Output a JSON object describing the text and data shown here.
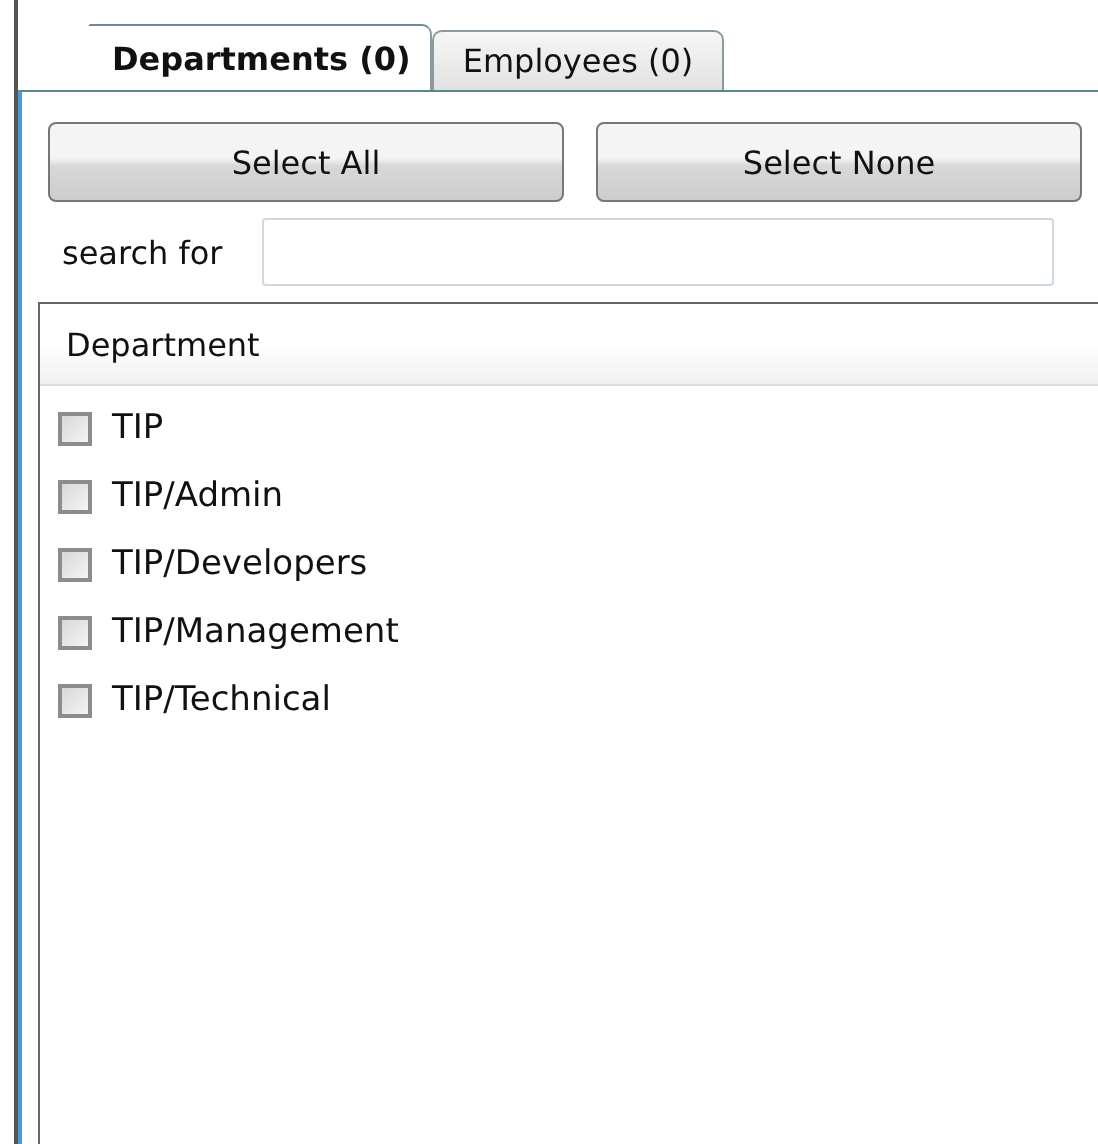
{
  "tabs": [
    {
      "label": "Departments (0)",
      "selected": true
    },
    {
      "label": "Employees (0)",
      "selected": false
    }
  ],
  "buttons": [
    "Select All",
    "Select None"
  ],
  "search": {
    "label": "search for"
  },
  "list": {
    "column": "Department",
    "items": [
      {
        "label": "TIP",
        "checked": false
      },
      {
        "label": "TIP/Admin",
        "checked": false
      },
      {
        "label": "TIP/Developers",
        "checked": false
      },
      {
        "label": "TIP/Management",
        "checked": false
      },
      {
        "label": "TIP/Technical",
        "checked": false
      }
    ]
  }
}
